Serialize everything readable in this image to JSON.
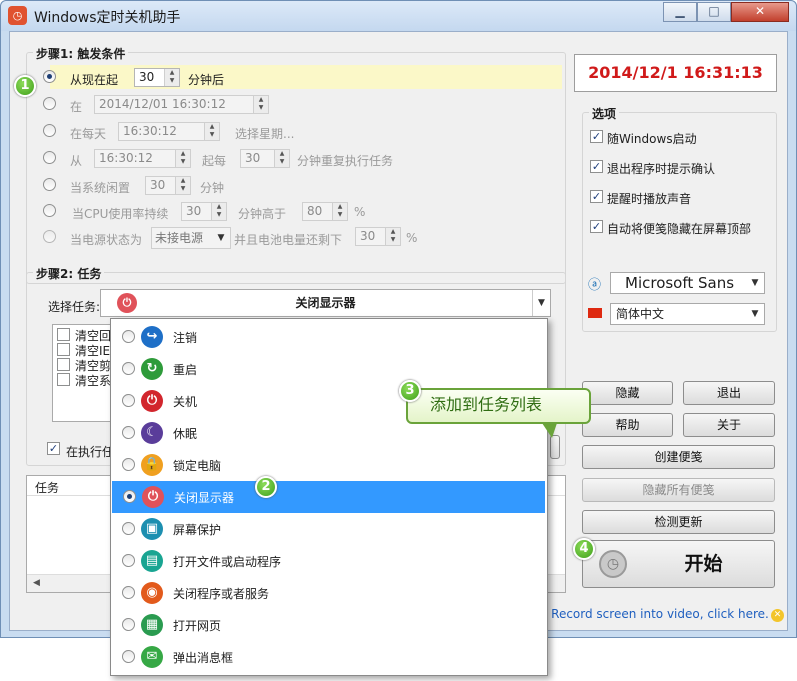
{
  "window": {
    "title": "Windows定时关机助手"
  },
  "step1": {
    "title": "步骤1: 触发条件",
    "rows": [
      {
        "label": "从现在起",
        "value": "30",
        "suffix": "分钟后",
        "selected": true
      },
      {
        "label": "在",
        "value": "2014/12/01  16:30:12"
      },
      {
        "label": "在每天",
        "value": "16:30:12",
        "suffix": "选择星期..."
      },
      {
        "label": "从",
        "value": "16:30:12",
        "mid": "起每",
        "value2": "30",
        "suffix": "分钟重复执行任务"
      },
      {
        "label": "当系统闲置",
        "value": "30",
        "suffix": "分钟"
      },
      {
        "label": "当CPU使用率持续",
        "value": "30",
        "mid": "分钟高于",
        "value2": "80",
        "suffix": "%"
      },
      {
        "label": "当电源状态为",
        "value": "未接电源",
        "mid": "并且电池电量还剩下",
        "value2": "30",
        "suffix": "%"
      }
    ]
  },
  "step2": {
    "title": "步骤2: 任务",
    "select_label": "选择任务:",
    "selected_task": "关闭显示器",
    "list_items": [
      "清空回",
      "清空IE",
      "清空剪",
      "清空系"
    ],
    "exec_checkbox_label": "在执行任",
    "task_col_header": "任务"
  },
  "clock": "2014/12/1 16:31:13",
  "options": {
    "title": "选项",
    "items": [
      {
        "label": "随Windows启动",
        "checked": true
      },
      {
        "label": "退出程序时提示确认",
        "checked": true
      },
      {
        "label": "提醒时播放声音",
        "checked": true
      },
      {
        "label": "自动将便笺隐藏在屏幕顶部",
        "checked": true
      }
    ],
    "font_value": "Microsoft Sans",
    "language_value": "简体中文"
  },
  "buttons": {
    "hide": "隐藏",
    "exit": "退出",
    "help": "帮助",
    "about": "关于",
    "create_note": "创建便笺",
    "hide_notes": "隐藏所有便笺",
    "check_update": "检测更新",
    "start": "开始"
  },
  "dropdown": {
    "options": [
      {
        "label": "注销",
        "icon": "logoff-icon",
        "color": "#1e6fc7",
        "glyph": "↪"
      },
      {
        "label": "重启",
        "icon": "restart-icon",
        "color": "#2e9b3a",
        "glyph": "↻"
      },
      {
        "label": "关机",
        "icon": "power-icon",
        "color": "#d2262d",
        "glyph": "⏻"
      },
      {
        "label": "休眠",
        "icon": "sleep-icon",
        "color": "#5a3d9a",
        "glyph": "☾"
      },
      {
        "label": "锁定电脑",
        "icon": "lock-icon",
        "color": "#f0a020",
        "glyph": "🔒"
      },
      {
        "label": "关闭显示器",
        "icon": "monitor-off-icon",
        "color": "#e0525a",
        "glyph": "⏻",
        "selected": true
      },
      {
        "label": "屏幕保护",
        "icon": "screensaver-icon",
        "color": "#1d8fb0",
        "glyph": "▣"
      },
      {
        "label": "打开文件或启动程序",
        "icon": "open-program-icon",
        "color": "#19a592",
        "glyph": "▤"
      },
      {
        "label": "关闭程序或者服务",
        "icon": "close-program-icon",
        "color": "#e25a1c",
        "glyph": "◉"
      },
      {
        "label": "打开网页",
        "icon": "web-icon",
        "color": "#2a9b50",
        "glyph": "▦"
      },
      {
        "label": "弹出消息框",
        "icon": "message-icon",
        "color": "#36a845",
        "glyph": "✉"
      }
    ]
  },
  "tooltip": "添加到任务列表",
  "badges": [
    "1",
    "2",
    "3",
    "4"
  ],
  "footer_link": "o Record screen into video, click here."
}
